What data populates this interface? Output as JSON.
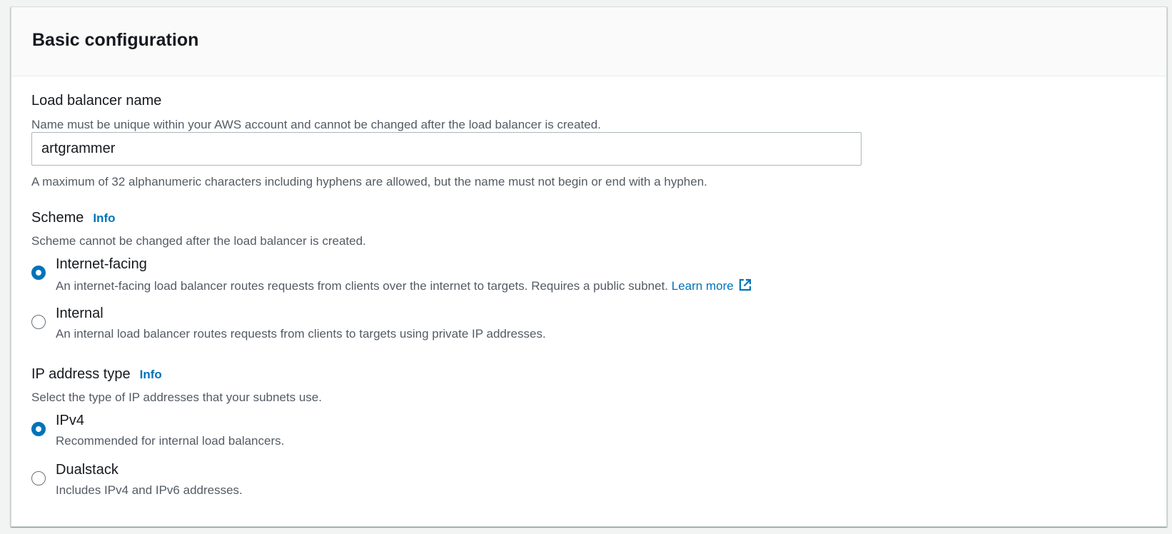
{
  "panel": {
    "title": "Basic configuration"
  },
  "load_balancer_name": {
    "label": "Load balancer name",
    "description": "Name must be unique within your AWS account and cannot be changed after the load balancer is created.",
    "value": "artgrammer",
    "constraint": "A maximum of 32 alphanumeric characters including hyphens are allowed, but the name must not begin or end with a hyphen."
  },
  "scheme": {
    "label": "Scheme",
    "info": "Info",
    "description": "Scheme cannot be changed after the load balancer is created.",
    "options": [
      {
        "label": "Internet-facing",
        "description": "An internet-facing load balancer routes requests from clients over the internet to targets. Requires a public subnet.",
        "link": "Learn more",
        "link_icon": "external-link-icon",
        "selected": true
      },
      {
        "label": "Internal",
        "description": "An internal load balancer routes requests from clients to targets using private IP addresses.",
        "selected": false
      }
    ]
  },
  "ip_address_type": {
    "label": "IP address type",
    "info": "Info",
    "description": "Select the type of IP addresses that your subnets use.",
    "options": [
      {
        "label": "IPv4",
        "description": "Recommended for internal load balancers.",
        "selected": true
      },
      {
        "label": "Dualstack",
        "description": "Includes IPv4 and IPv6 addresses.",
        "selected": false
      }
    ]
  },
  "colors": {
    "accent": "#0073bb",
    "text": "#16191f",
    "secondary_text": "#545b64",
    "border": "#aab7b8"
  }
}
